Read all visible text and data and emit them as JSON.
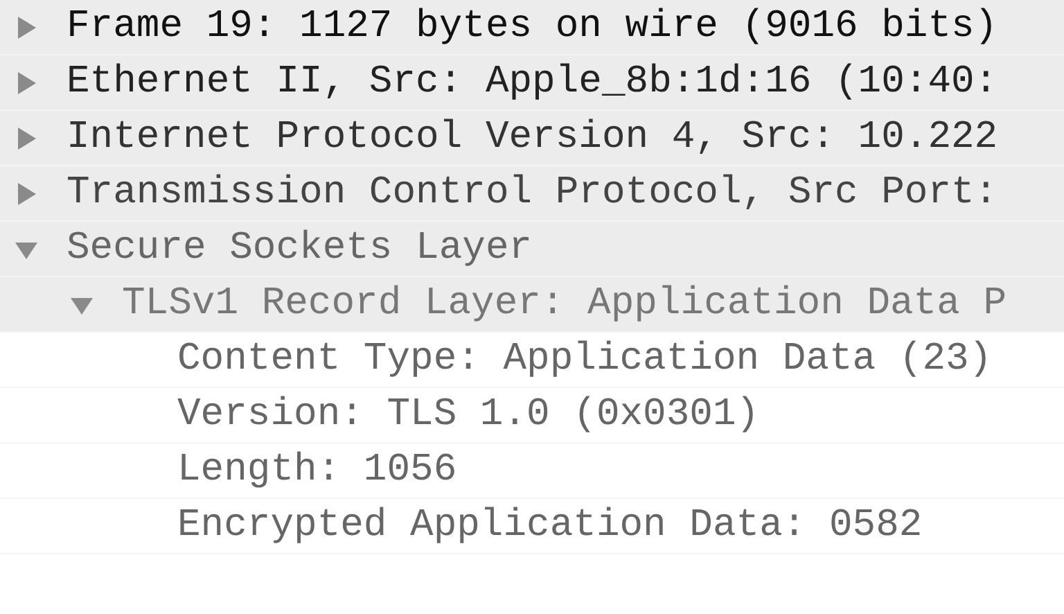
{
  "packet_details": [
    {
      "label": "Frame 19: 1127 bytes on wire (9016 bits)",
      "expanded": false
    },
    {
      "label": "Ethernet II, Src: Apple_8b:1d:16 (10:40:",
      "expanded": false
    },
    {
      "label": "Internet Protocol Version 4, Src: 10.222",
      "expanded": false
    },
    {
      "label": "Transmission Control Protocol, Src Port:",
      "expanded": false
    },
    {
      "label": "Secure Sockets Layer",
      "expanded": true,
      "children": [
        {
          "label": "TLSv1 Record Layer: Application Data P",
          "expanded": true,
          "children": [
            {
              "label": "Content Type: Application Data (23)"
            },
            {
              "label": "Version: TLS 1.0 (0x0301)"
            },
            {
              "label": "Length: 1056"
            },
            {
              "label": "Encrypted Application Data: 0582"
            }
          ]
        }
      ]
    }
  ]
}
